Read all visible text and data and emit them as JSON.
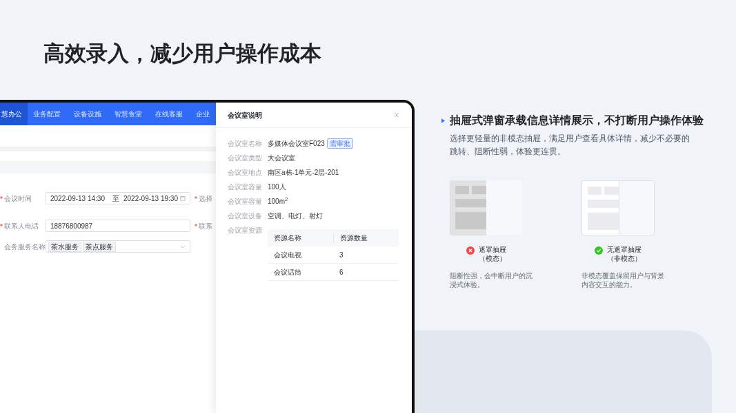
{
  "headline": "高效录入，减少用户操作成本",
  "app": {
    "nav_tabs": [
      {
        "label": "慧办公",
        "selected": true
      },
      {
        "label": "业务配置",
        "selected": false
      },
      {
        "label": "设备设施",
        "selected": false
      },
      {
        "label": "智慧食堂",
        "selected": false
      },
      {
        "label": "在线客服",
        "selected": false
      },
      {
        "label": "企业",
        "selected": false
      }
    ],
    "form_rows": [
      {
        "kind": "date_range",
        "label": "会议时间",
        "required": true,
        "start": "2022-09-13 14:30",
        "separator": "至",
        "end": "2022-09-13 19:30",
        "side_label": "选择",
        "side_required": true
      },
      {
        "kind": "input",
        "label": "联系人电话",
        "required": true,
        "value": "18876800987",
        "side_label": "联系",
        "side_required": true
      },
      {
        "kind": "select",
        "label": "会务服务名称",
        "required": false,
        "tags": [
          "茶水服务",
          "茶点服务"
        ]
      }
    ]
  },
  "drawer": {
    "title": "会议室说明",
    "fields": [
      {
        "label": "会议室名称",
        "value": "多媒体会议室F023",
        "tag": "需审批"
      },
      {
        "label": "会议室类型",
        "value": "大会议室"
      },
      {
        "label": "会议室地点",
        "value": "南区a栋-1单元-2层-201"
      },
      {
        "label": "会议室容量",
        "value": "100人"
      },
      {
        "label": "会议室容量",
        "value": "100m$^{2}$"
      },
      {
        "label": "会议室设备",
        "value": "空调、电灯、射灯"
      },
      {
        "label": "会议室资源"
      }
    ],
    "table": {
      "columns": [
        "资源名称",
        "资源数量"
      ],
      "rows": [
        [
          "会议电视",
          "3"
        ],
        [
          "会议话筒",
          "6"
        ]
      ]
    }
  },
  "feature": {
    "title": "抽屉式弹窗承载信息详情展示，不打断用户操作体验",
    "description": "选择更轻量的非模态抽屉，满足用户查看具体详情，减少不必要的跳转、阻断性弱，体验更连贯。",
    "options": [
      {
        "kind": "bad",
        "masked": true,
        "title": "遮罩抽屉",
        "subtitle": "（模态）",
        "description": "阻断性强，会中断用户的沉浸式体验。"
      },
      {
        "kind": "good",
        "masked": false,
        "title": "无遮罩抽屉",
        "subtitle": "（非模态）",
        "description": "非模态覆盖保留用户与背景内容交互的能力。"
      }
    ]
  }
}
